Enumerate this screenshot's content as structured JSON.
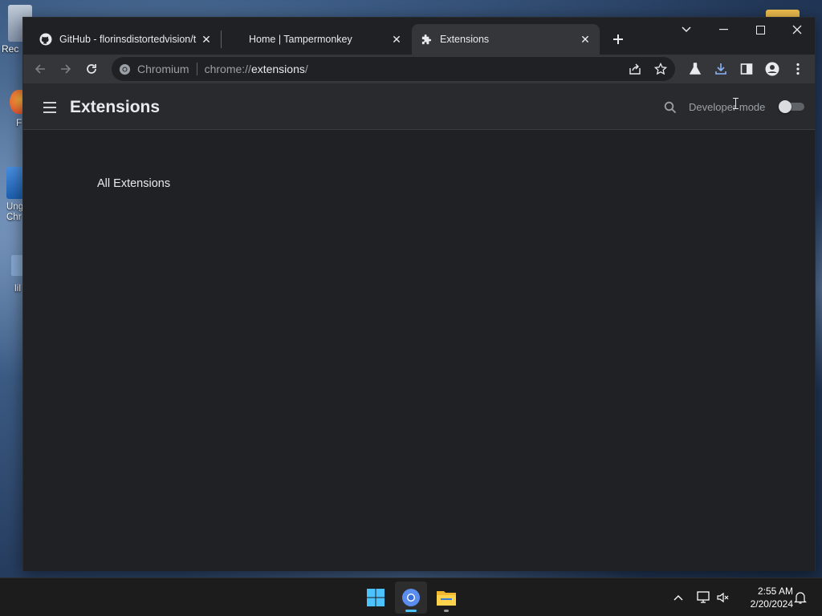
{
  "desktop": {
    "icons": [
      {
        "label": "Rec"
      },
      {
        "label": "F"
      },
      {
        "label": "Ung Chr"
      },
      {
        "label": "lil"
      }
    ]
  },
  "browser": {
    "tabs": [
      {
        "label": "GitHub - florinsdistortedvision/t",
        "icon": "github-icon",
        "active": false
      },
      {
        "label": "Home | Tampermonkey",
        "icon": "",
        "active": false
      },
      {
        "label": "Extensions",
        "icon": "puzzle-icon",
        "active": true
      }
    ],
    "omnibox": {
      "chip": "Chromium",
      "url_prefix": "chrome://",
      "url_main": "extensions",
      "url_suffix": "/"
    }
  },
  "extensions_page": {
    "title": "Extensions",
    "developer_mode_label": "Developer mode",
    "developer_mode_on": false,
    "section_title": "All Extensions"
  },
  "taskbar": {
    "time": "2:55 AM",
    "date": "2/20/2024"
  },
  "colors": {
    "accent_blue": "#8ab4f8",
    "page_bg": "#202124",
    "header_bg": "#292a2d",
    "toolbar_bg": "#35363a"
  }
}
